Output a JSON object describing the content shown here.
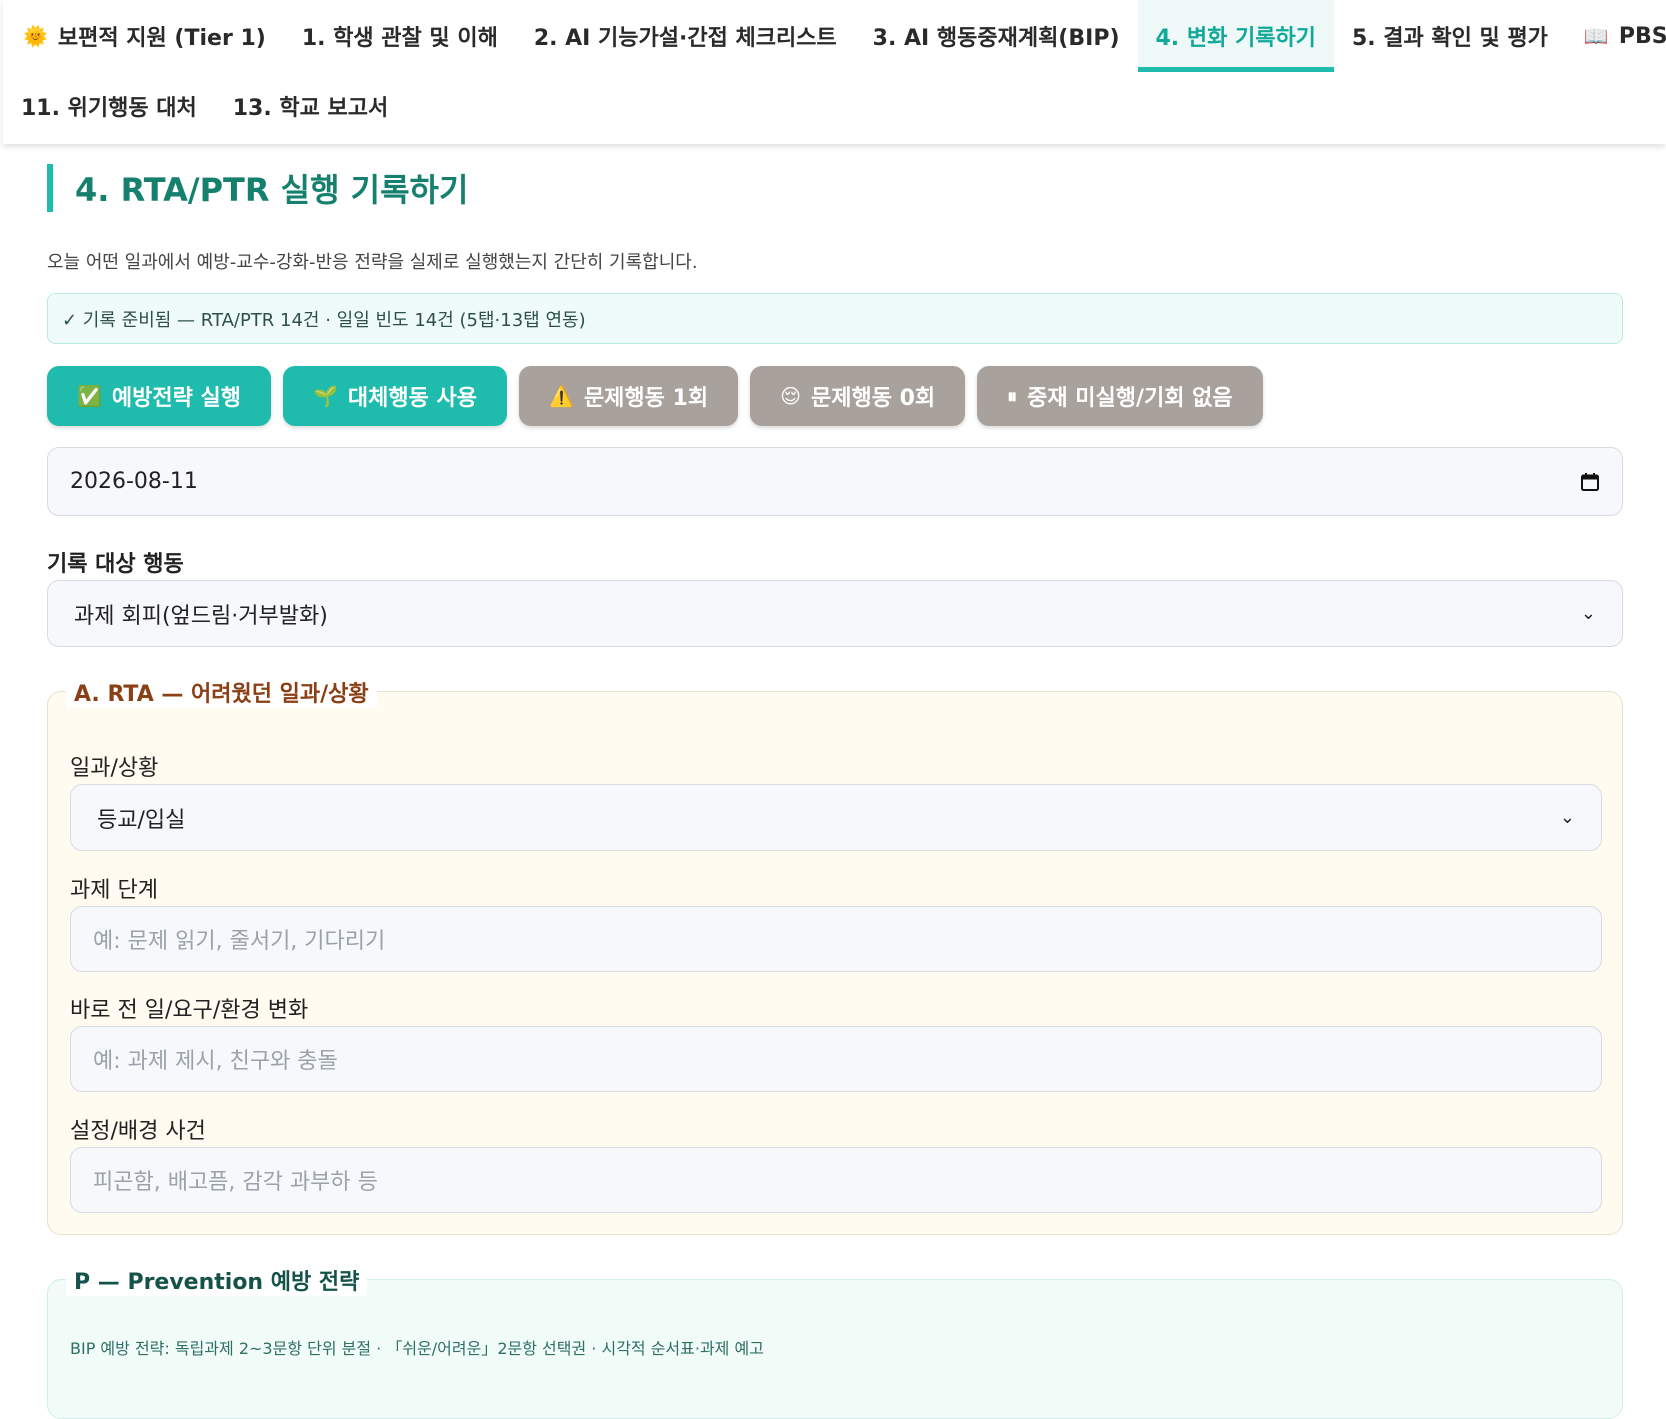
{
  "nav": {
    "tabs_row1": [
      {
        "icon": "sun-icon",
        "glyph": "🌞",
        "label": "보편적 지원 (Tier 1)",
        "active": false
      },
      {
        "label": "1. 학생 관찰 및 이해",
        "active": false
      },
      {
        "label": "2. AI 기능가설·간접 체크리스트",
        "active": false
      },
      {
        "label": "3. AI 행동중재계획(BIP)",
        "active": false
      },
      {
        "label": "4. 변화 기록하기",
        "active": true
      },
      {
        "label": "5. 결과 확인 및 평가",
        "active": false
      },
      {
        "icon": "book-icon",
        "glyph": "📖",
        "label": "PBS Q&A",
        "active": false
      }
    ],
    "tabs_row2": [
      {
        "label": "11. 위기행동 대처"
      },
      {
        "label": "13. 학교 보고서"
      }
    ]
  },
  "page": {
    "title": "4. RTA/PTR 실행 기록하기",
    "description": "오늘 어떤 일과에서 예방-교수-강화-반응 전략을 실제로 실행했는지 간단히 기록합니다.",
    "status": "✓ 기록 준비됨 — RTA/PTR 14건 · 일일 빈도 14건 (5탭·13탭 연동)"
  },
  "quick_buttons": [
    {
      "icon": "check-box-icon",
      "glyph": "✅",
      "label": "예방전략 실행",
      "color": "#1fbcad"
    },
    {
      "icon": "seedling-icon",
      "glyph": "🌱",
      "label": "대체행동 사용",
      "color": "#1fbcad"
    },
    {
      "icon": "warning-icon",
      "glyph": "⚠️",
      "label": "문제행동 1회",
      "color": "#a8a19c"
    },
    {
      "icon": "relieved-face-icon",
      "glyph": "😌",
      "label": "문제행동 0회",
      "color": "#a8a19c"
    },
    {
      "icon": "pause-icon",
      "glyph": "⏸",
      "label": "중재 미실행/기회 없음",
      "color": "#a8a19c"
    }
  ],
  "date_field": {
    "value": "2026-08-11"
  },
  "target_behavior": {
    "label": "기록 대상 행동",
    "selected": "과제 회피(엎드림·거부발화)"
  },
  "section_a": {
    "legend": "A. RTA — 어려웠던 일과/상황",
    "routine_label": "일과/상황",
    "routine_selected": "등교/입실",
    "task_step_label": "과제 단계",
    "task_step_placeholder": "예: 문제 읽기, 줄서기, 기다리기",
    "antecedent_label": "바로 전 일/요구/환경 변화",
    "antecedent_placeholder": "예: 과제 제시, 친구와 충돌",
    "setting_event_label": "설정/배경 사건",
    "setting_event_placeholder": "피곤함, 배고픔, 감각 과부하 등"
  },
  "section_p": {
    "legend": "P — Prevention 예방 전략",
    "bip_note": "BIP 예방 전략: 독립과제 2~3문항 단위 분절 · 「쉬운/어려운」2문항 선택권 · 시각적 순서표·과제 예고"
  },
  "colors": {
    "accent": "#1fbcad",
    "title": "#16806f",
    "legend_warm": "#8a3f14",
    "legend_cool": "#14524a"
  }
}
